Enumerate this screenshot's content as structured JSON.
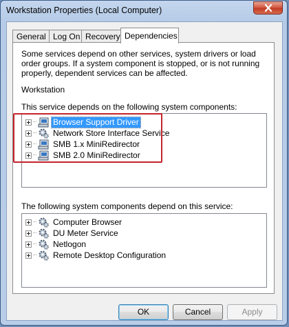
{
  "window": {
    "title": "Workstation Properties (Local Computer)",
    "colors": {
      "selection": "#3399ff",
      "annotation_box": "#c4232a"
    }
  },
  "tabs": [
    {
      "label": "General",
      "active": false
    },
    {
      "label": "Log On",
      "active": false
    },
    {
      "label": "Recovery",
      "active": false
    },
    {
      "label": "Dependencies",
      "active": true
    }
  ],
  "dependencies": {
    "description": "Some services depend on other services, system drivers or load order groups. If a system component is stopped, or is not running properly, dependent services can be affected.",
    "service_name": "Workstation",
    "depends_on_label": "This service depends on the following system components:",
    "depends_on": [
      {
        "label": "Browser Support Driver",
        "icon": "driver-icon",
        "selected": true
      },
      {
        "label": "Network Store Interface Service",
        "icon": "service-gear-icon",
        "selected": false
      },
      {
        "label": "SMB 1.x MiniRedirector",
        "icon": "driver-icon",
        "selected": false
      },
      {
        "label": "SMB 2.0 MiniRedirector",
        "icon": "driver-icon",
        "selected": false
      }
    ],
    "dependents_label": "The following system components depend on this service:",
    "dependents": [
      {
        "label": "Computer Browser",
        "icon": "service-gear-icon"
      },
      {
        "label": "DU Meter Service",
        "icon": "service-gear-icon"
      },
      {
        "label": "Netlogon",
        "icon": "service-gear-icon"
      },
      {
        "label": "Remote Desktop Configuration",
        "icon": "service-gear-icon"
      }
    ]
  },
  "buttons": {
    "ok": "OK",
    "cancel": "Cancel",
    "apply": "Apply"
  }
}
